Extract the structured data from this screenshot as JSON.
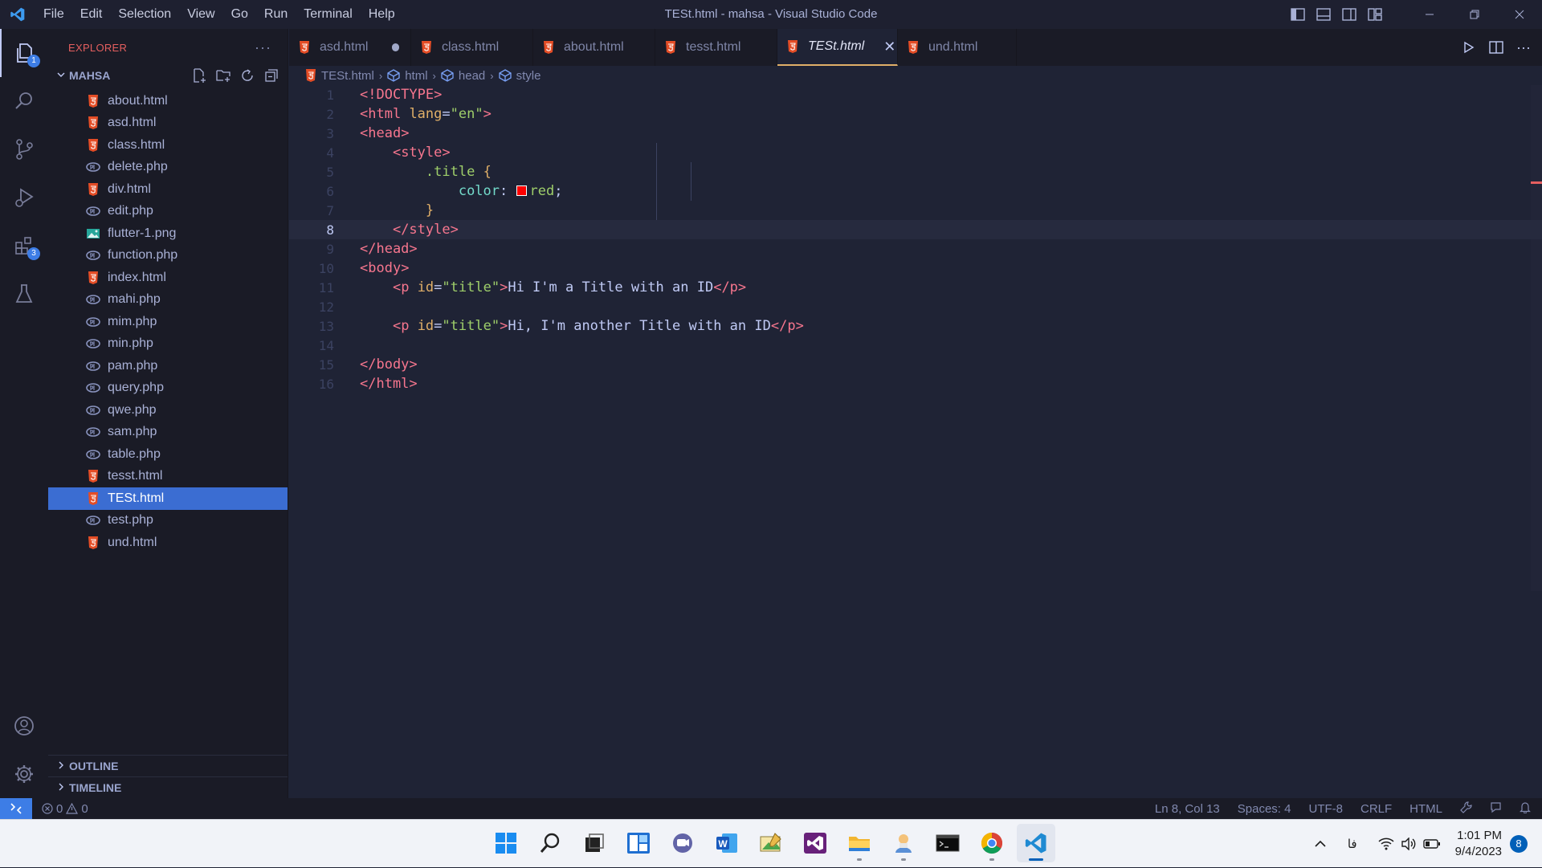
{
  "window": {
    "title": "TESt.html - mahsa - Visual Studio Code",
    "menu": [
      "File",
      "Edit",
      "Selection",
      "View",
      "Go",
      "Run",
      "Terminal",
      "Help"
    ]
  },
  "activity": {
    "explorer_badge": "1",
    "extensions_badge": "3"
  },
  "sidebar": {
    "title": "EXPLORER",
    "more": "···",
    "folder": "MAHSA",
    "files": [
      {
        "name": "about.html",
        "type": "html"
      },
      {
        "name": "asd.html",
        "type": "html"
      },
      {
        "name": "class.html",
        "type": "html"
      },
      {
        "name": "delete.php",
        "type": "php"
      },
      {
        "name": "div.html",
        "type": "html"
      },
      {
        "name": "edit.php",
        "type": "php"
      },
      {
        "name": "flutter-1.png",
        "type": "image"
      },
      {
        "name": "function.php",
        "type": "php"
      },
      {
        "name": "index.html",
        "type": "html"
      },
      {
        "name": "mahi.php",
        "type": "php"
      },
      {
        "name": "mim.php",
        "type": "php"
      },
      {
        "name": "min.php",
        "type": "php"
      },
      {
        "name": "pam.php",
        "type": "php"
      },
      {
        "name": "query.php",
        "type": "php"
      },
      {
        "name": "qwe.php",
        "type": "php"
      },
      {
        "name": "sam.php",
        "type": "php"
      },
      {
        "name": "table.php",
        "type": "php"
      },
      {
        "name": "tesst.html",
        "type": "html"
      },
      {
        "name": "TESt.html",
        "type": "html",
        "selected": true
      },
      {
        "name": "test.php",
        "type": "php"
      },
      {
        "name": "und.html",
        "type": "html"
      }
    ],
    "outline": "OUTLINE",
    "timeline": "TIMELINE"
  },
  "tabs": [
    {
      "label": "asd.html",
      "modified": true
    },
    {
      "label": "class.html"
    },
    {
      "label": "about.html"
    },
    {
      "label": "tesst.html"
    },
    {
      "label": "TESt.html",
      "active": true
    },
    {
      "label": "und.html"
    }
  ],
  "breadcrumb": [
    "TESt.html",
    "html",
    "head",
    "style"
  ],
  "editor": {
    "current_line": 8,
    "line_numbers": [
      "1",
      "2",
      "3",
      "4",
      "5",
      "6",
      "7",
      "8",
      "9",
      "10",
      "11",
      "12",
      "13",
      "14",
      "15",
      "16"
    ],
    "lines": [
      "<!DOCTYPE html>",
      "<html lang=\"en\">",
      "<head>",
      "    <style>",
      "        .title {",
      "            color: red;",
      "        }",
      "    </style>",
      "</head>",
      "<body>",
      "    <p id=\"title\">Hi I'm a Title with an ID</p>",
      "",
      "    <p id=\"title\">Hi, I'm another Title with an ID</p>",
      "",
      "</body>",
      "</html>"
    ],
    "color_swatch": "#ff0000"
  },
  "status": {
    "errors": "0",
    "warnings": "0",
    "position": "Ln 8, Col 13",
    "spaces": "Spaces: 4",
    "encoding": "UTF-8",
    "eol": "CRLF",
    "language": "HTML"
  },
  "taskbar": {
    "apps": [
      "start-icon",
      "search-icon",
      "task-view-icon",
      "widgets-icon",
      "teams-chat-icon",
      "word-icon",
      "image-editor-icon",
      "visual-studio-icon",
      "file-explorer-icon",
      "app-icon",
      "terminal-icon",
      "chrome-icon",
      "vscode-icon"
    ],
    "lang": "فا",
    "time": "1:01 PM",
    "date": "9/4/2023",
    "notifications": "8"
  },
  "colors": {
    "accent": "#3d7de6",
    "html_icon": "#e44d26",
    "php_icon": "#8993be",
    "tag": "#f7768e",
    "attribute": "#e0af68",
    "string": "#9ece6a"
  }
}
